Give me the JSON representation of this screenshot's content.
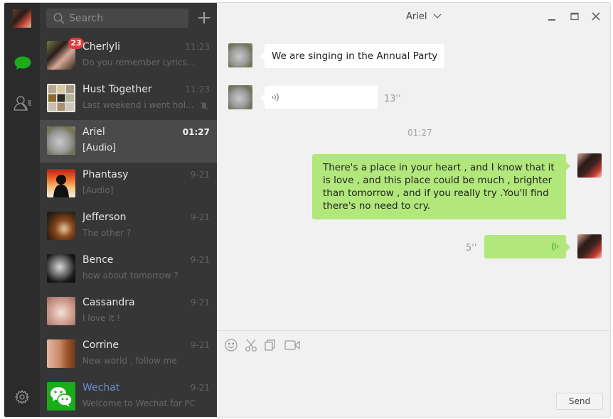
{
  "window": {
    "title": "Ariel",
    "controls": [
      "minimize",
      "maximize",
      "close"
    ]
  },
  "rail": {
    "items": [
      {
        "name": "profile-avatar"
      },
      {
        "name": "chats-icon",
        "active": true
      },
      {
        "name": "contacts-icon"
      },
      {
        "name": "settings-icon"
      }
    ]
  },
  "search": {
    "placeholder": "Search",
    "value": ""
  },
  "conversations": [
    {
      "name": "Cherlyli",
      "time": "11:23",
      "preview": "Do you remember Lyrics....",
      "badge": "23"
    },
    {
      "name": "Hust Together",
      "time": "11:23",
      "preview": "Last weekend i went hol...",
      "muted": true
    },
    {
      "name": "Ariel",
      "time": "01:27",
      "preview": "[Audio]",
      "active": true
    },
    {
      "name": "Phantasy",
      "time": "9-21",
      "preview": "[Audio]"
    },
    {
      "name": "Jefferson",
      "time": "9-21",
      "preview": "The other ?"
    },
    {
      "name": "Bence",
      "time": "9-21",
      "preview": "how about tomorrow ?"
    },
    {
      "name": "Cassandra",
      "time": "9-21",
      "preview": "I love it  !"
    },
    {
      "name": "Corrine",
      "time": "9-21",
      "preview": "New  world , follow me"
    },
    {
      "name": "Wechat",
      "time": "9-21",
      "preview": "Welcome to Wechat for PC..."
    }
  ],
  "messages": {
    "m1": {
      "text": "We are singing in the Annual Party",
      "direction": "incoming"
    },
    "m2": {
      "type": "audio",
      "duration": "13''",
      "direction": "incoming"
    },
    "timestamp": "01:27",
    "m3": {
      "text": "There's a place in your heart , and I know that it is love , and this place could be much , brighter than tomorrow , and if you really try .You'll find there's no need to cry.",
      "direction": "outgoing"
    },
    "m4": {
      "type": "audio",
      "duration": "5''",
      "direction": "outgoing"
    }
  },
  "composer": {
    "tools": [
      "emoji",
      "screenshot",
      "file",
      "video-call"
    ],
    "send_label": "Send",
    "value": ""
  },
  "colors": {
    "accent_green": "#1aad19",
    "outgoing_bubble": "#b2e77c",
    "badge_red": "#e3393c",
    "link_blue": "#6d8dd0"
  }
}
